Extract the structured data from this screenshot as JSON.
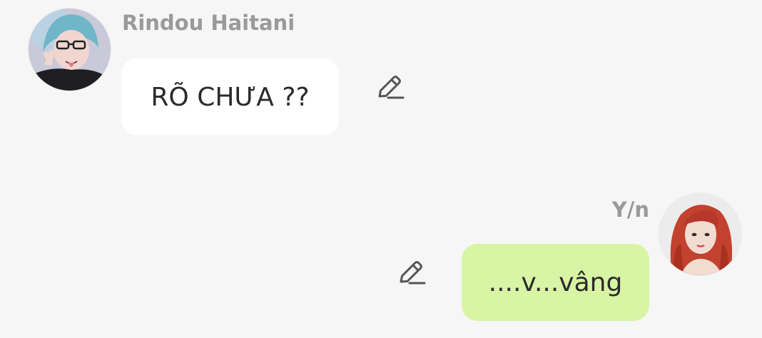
{
  "theme": {
    "background": "#f6f6f6",
    "name_color": "#9a9a9a",
    "incoming_bubble": "#ffffff",
    "outgoing_bubble": "#d7f5a4",
    "text_color": "#2b2b2b",
    "icon_color": "#555555"
  },
  "messages": [
    {
      "sender": "Rindou Haitani",
      "text": "RÕ CHƯA ??",
      "side": "left",
      "avatar_icon": "avatar-rindou",
      "action_icon": "pencil-edit-icon"
    },
    {
      "sender": "Y/n",
      "text": "....v...vâng",
      "side": "right",
      "avatar_icon": "avatar-yn",
      "action_icon": "pencil-edit-icon"
    }
  ]
}
